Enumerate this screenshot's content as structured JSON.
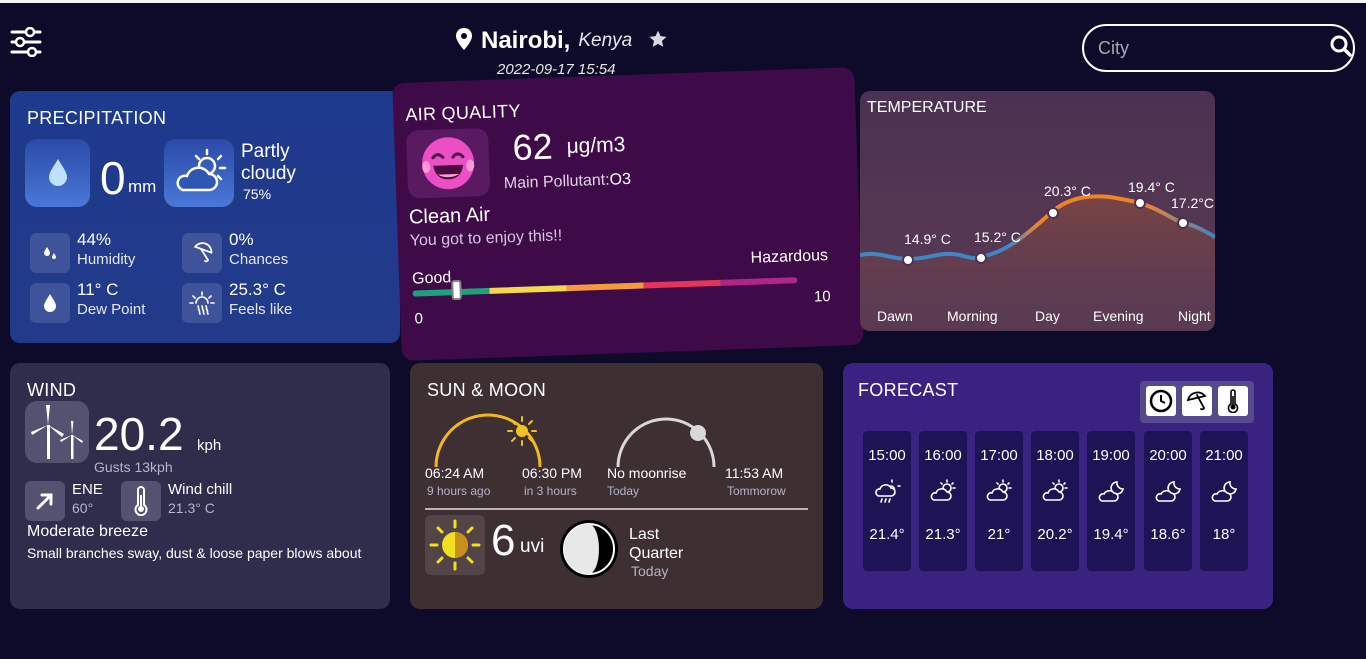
{
  "header": {
    "city": "Nairobi,",
    "country": "Kenya",
    "datetime": "2022-09-17 15:54",
    "search_placeholder": "City"
  },
  "precipitation": {
    "title": "PRECIPITATION",
    "amount": "0",
    "unit": "mm",
    "condition": "Partly cloudy",
    "condition_percent": "75%",
    "humidity": {
      "value": "44%",
      "label": "Humidity"
    },
    "chances": {
      "value": "0%",
      "label": "Chances"
    },
    "dew_point": {
      "value": "11° C",
      "label": "Dew Point"
    },
    "feels_like": {
      "value": "25.3° C",
      "label": "Feels like"
    }
  },
  "air_quality": {
    "title": "AIR QUALITY",
    "value": "62",
    "unit": "μg/m3",
    "pollutant_label": "Main Pollutant:",
    "pollutant": "O3",
    "status": "Clean Air",
    "message": "You got to enjoy this!!",
    "scale_low_label": "Good",
    "scale_high_label": "Hazardous",
    "scale_min": "0",
    "scale_max": "10",
    "level_fraction": 0.1
  },
  "temperature": {
    "title": "TEMPERATURE",
    "periods": [
      "Dawn",
      "Morning",
      "Day",
      "Evening",
      "Night"
    ],
    "points": [
      {
        "label": "14.9° C"
      },
      {
        "label": "15.2° C"
      },
      {
        "label": "20.3° C"
      },
      {
        "label": "19.4° C"
      },
      {
        "label": "17.2°C"
      }
    ]
  },
  "wind": {
    "title": "WIND",
    "speed": "20.2",
    "unit": "kph",
    "gusts": "Gusts 13kph",
    "direction": "ENE",
    "degrees": "60°",
    "chill_label": "Wind chill",
    "chill_value": "21.3° C",
    "description_title": "Moderate breeze",
    "description": "Small branches sway, dust & loose paper blows about"
  },
  "sun_moon": {
    "title": "SUN & MOON",
    "sunrise": "06:24 AM",
    "sunrise_ago": "9 hours ago",
    "sunset": "06:30 PM",
    "sunset_in": "in 3 hours",
    "moonrise": "No moonrise",
    "moonrise_when": "Today",
    "moonset": "11:53 AM",
    "moonset_when": "Tommorow",
    "uv_value": "6",
    "uv_unit": "uvi",
    "moon_phase": "Last Quarter",
    "moon_phase_when": "Today"
  },
  "forecast": {
    "title": "FORECAST",
    "hours": [
      {
        "time": "15:00",
        "icon": "cloud-rain-sun-icon",
        "temp": "21.4°"
      },
      {
        "time": "16:00",
        "icon": "partly-cloudy-icon",
        "temp": "21.3°"
      },
      {
        "time": "17:00",
        "icon": "partly-cloudy-icon",
        "temp": "21°"
      },
      {
        "time": "18:00",
        "icon": "partly-cloudy-icon",
        "temp": "20.2°"
      },
      {
        "time": "19:00",
        "icon": "partly-cloudy-night-icon",
        "temp": "19.4°"
      },
      {
        "time": "20:00",
        "icon": "partly-cloudy-night-icon",
        "temp": "18.6°"
      },
      {
        "time": "21:00",
        "icon": "partly-cloudy-night-icon",
        "temp": "18°"
      }
    ]
  },
  "colors": {
    "background": "#0d0a2a",
    "precipitation_card": "#1e3a8c",
    "air_quality_card": "#3f0a48",
    "temperature_card": "#4b3252",
    "wind_card": "#302c4c",
    "sun_moon_card": "#3e2f33",
    "forecast_card": "#3a2380",
    "temp_line_cool": "#3f86c6",
    "temp_line_warm": "#f0832a"
  }
}
